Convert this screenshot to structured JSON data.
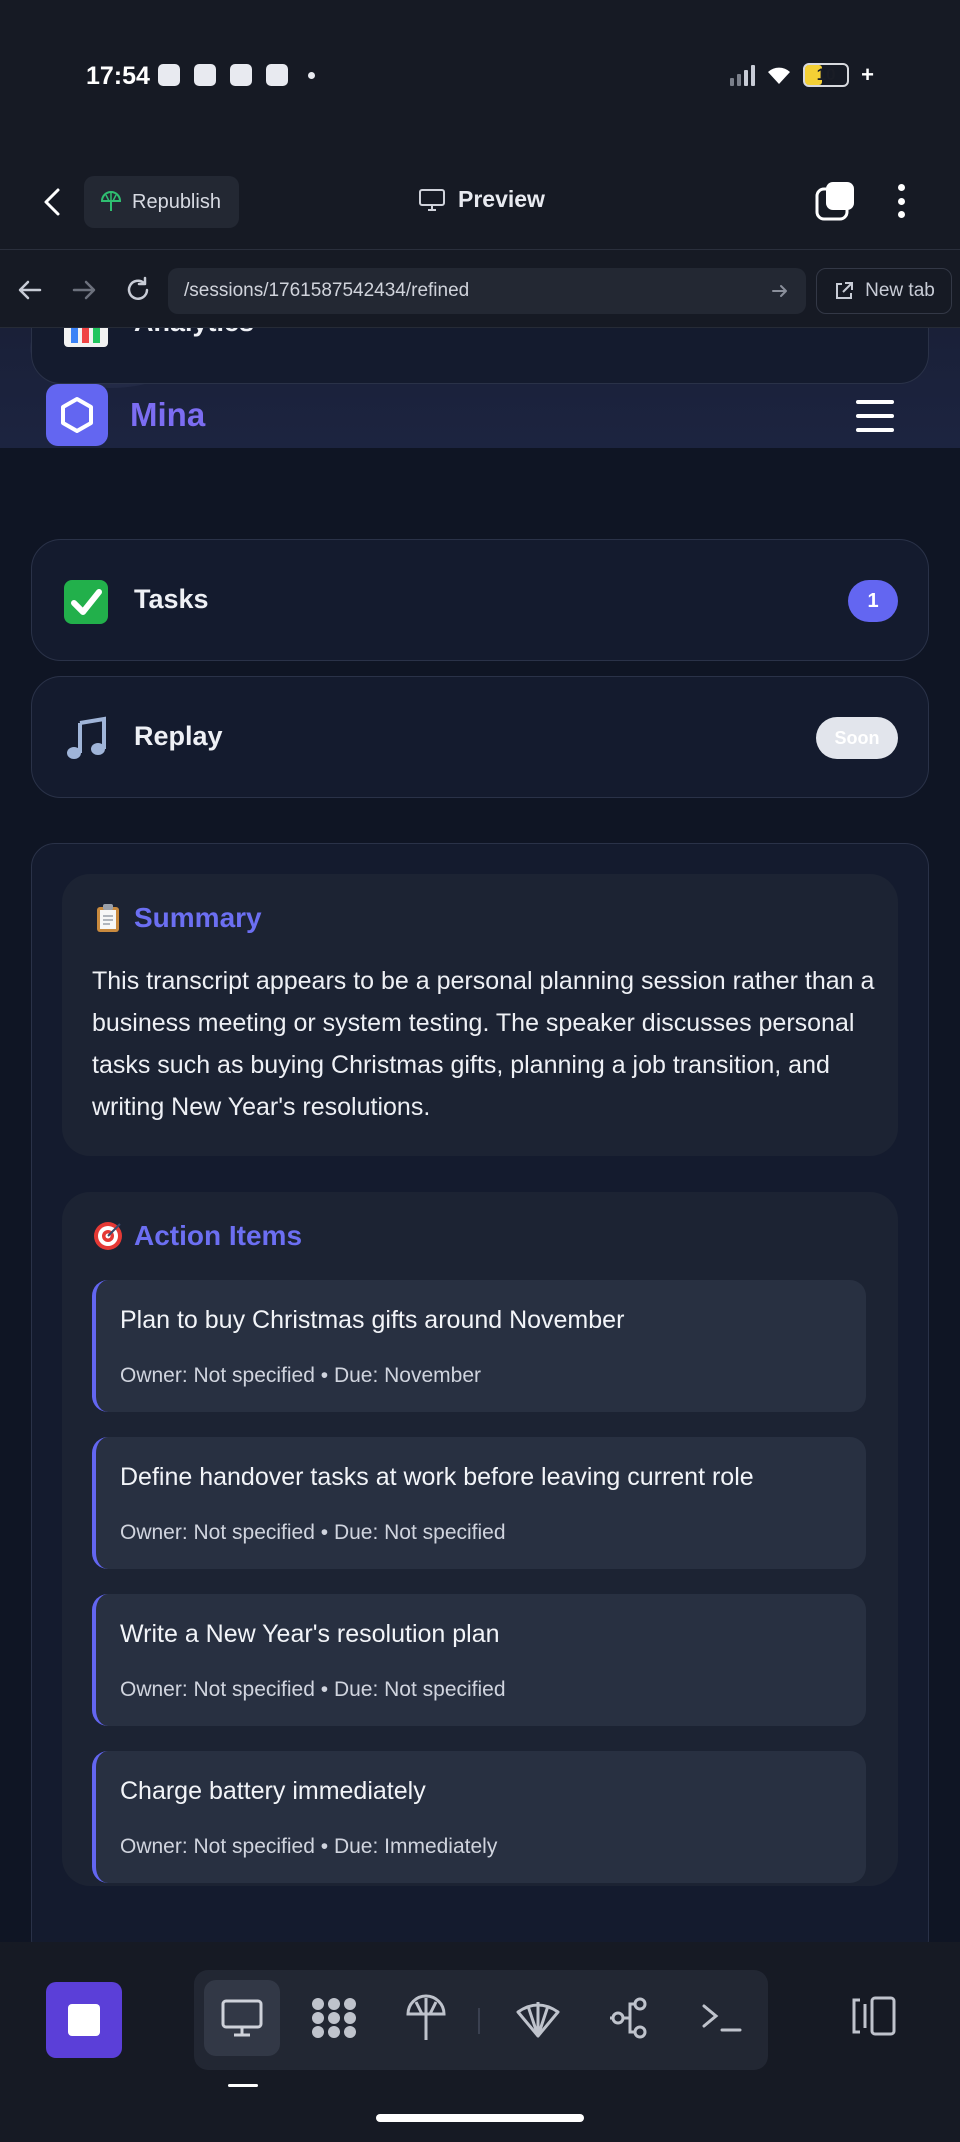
{
  "status_bar": {
    "time": "17:54",
    "battery": "10",
    "battery_suffix": "+"
  },
  "header": {
    "republish_label": "Republish",
    "preview_label": "Preview"
  },
  "browser": {
    "url": "/sessions/1761587542434/refined",
    "new_tab_label": "New tab"
  },
  "app": {
    "brand": "Mina",
    "nav_cards": [
      {
        "label": "Analytics",
        "icon": "bar-chart-emoji"
      },
      {
        "label": "Tasks",
        "icon": "check-mark-emoji",
        "badge": "1"
      },
      {
        "label": "Replay",
        "icon": "music-note-emoji",
        "badge": "Soon"
      }
    ]
  },
  "summary": {
    "title": "Summary",
    "icon": "clipboard-emoji",
    "text": "This transcript appears to be a personal planning session rather than a business meeting or system testing. The speaker discusses personal tasks such as buying Christmas gifts, planning a job transition, and writing New Year's resolutions."
  },
  "action_items": {
    "title": "Action Items",
    "icon": "target-emoji",
    "items": [
      {
        "title": "Plan to buy Christmas gifts around November",
        "meta": "Owner: Not specified • Due: November"
      },
      {
        "title": "Define handover tasks at work before leaving current role",
        "meta": "Owner: Not specified • Due: Not specified"
      },
      {
        "title": "Write a New Year's resolution plan",
        "meta": "Owner: Not specified • Due: Not specified"
      },
      {
        "title": "Charge battery immediately",
        "meta": "Owner: Not specified • Due: Immediately"
      }
    ]
  },
  "colors": {
    "accent": "#6366f1",
    "background": "#0f1524",
    "card": "#141b2e"
  }
}
